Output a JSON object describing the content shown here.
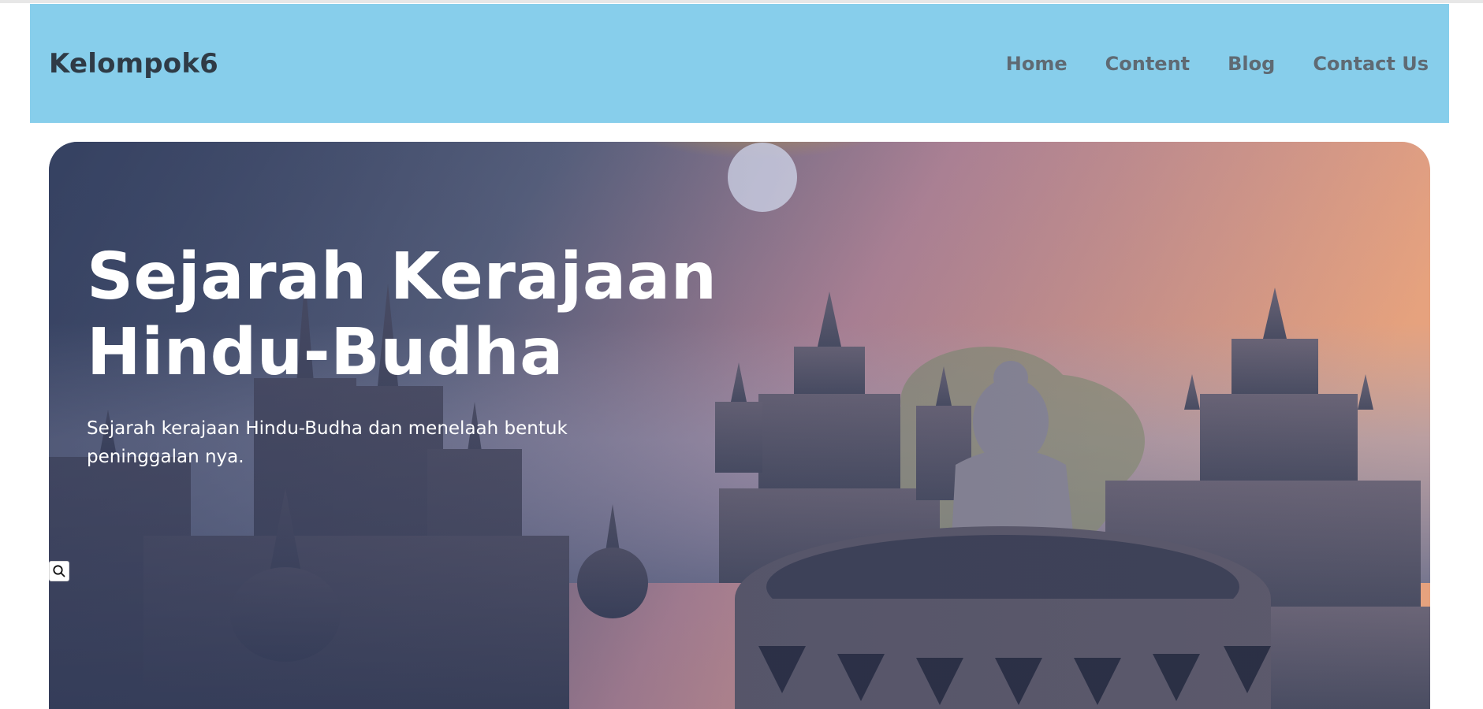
{
  "header": {
    "brand": "Kelompok6",
    "nav": [
      {
        "label": "Home"
      },
      {
        "label": "Content"
      },
      {
        "label": "Blog"
      },
      {
        "label": "Contact Us"
      }
    ]
  },
  "hero": {
    "title_line1": "Sejarah Kerajaan",
    "title_line2": "Hindu-Budha",
    "subtitle": "Sejarah kerajaan Hindu-Budha dan menelaah bentuk peninggalan nya."
  },
  "icons": {
    "search": "search-icon"
  },
  "colors": {
    "navbar_bg": "#87ceeb",
    "brand_text": "#2f3b46",
    "nav_text": "#5f6a73",
    "hero_text": "#ffffff"
  }
}
